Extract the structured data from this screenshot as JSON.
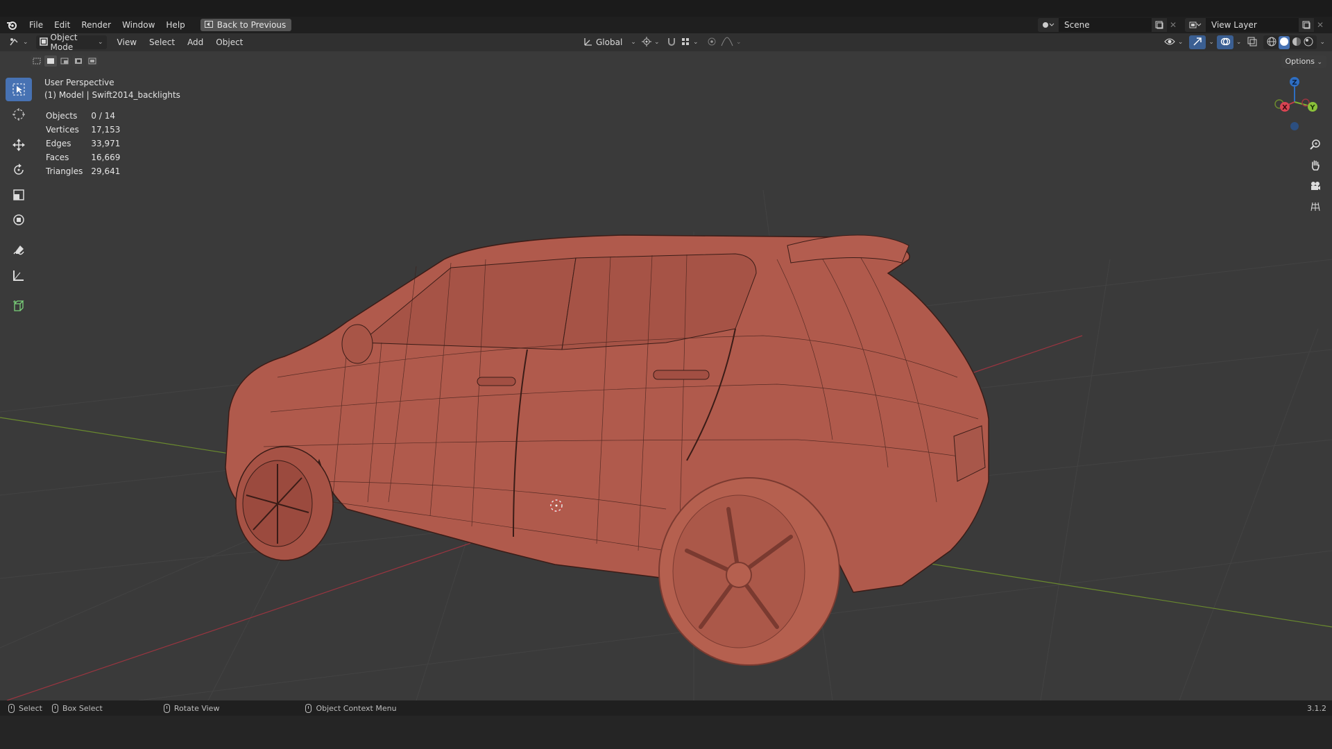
{
  "menubar": {
    "items": [
      "File",
      "Edit",
      "Render",
      "Window",
      "Help"
    ],
    "back_button": "Back to Previous",
    "scene": "Scene",
    "view_layer": "View Layer"
  },
  "header": {
    "mode": "Object Mode",
    "menus": [
      "View",
      "Select",
      "Add",
      "Object"
    ],
    "transform_orientation": "Global"
  },
  "viewport": {
    "perspective": "User Perspective",
    "object_info": "(1) Model | Swift2014_backlights",
    "options_label": "Options",
    "stats": [
      {
        "label": "Objects",
        "value": "0 / 14"
      },
      {
        "label": "Vertices",
        "value": "17,153"
      },
      {
        "label": "Edges",
        "value": "33,971"
      },
      {
        "label": "Faces",
        "value": "16,669"
      },
      {
        "label": "Triangles",
        "value": "29,641"
      }
    ],
    "gizmo_labels": {
      "z": "Z",
      "x": "X",
      "y": "Y"
    },
    "tools": [
      "select-box-icon",
      "cursor-icon",
      "move-icon",
      "rotate-icon",
      "scale-icon",
      "transform-icon",
      "annotate-icon",
      "measure-icon",
      "add-cube-icon"
    ],
    "nav": [
      "zoom-icon",
      "hand-pan-icon",
      "camera-icon",
      "grid-icon"
    ]
  },
  "statusbar": {
    "select": "Select",
    "box_select": "Box Select",
    "rotate_view": "Rotate View",
    "context_menu": "Object Context Menu",
    "version": "3.1.2"
  },
  "colors": {
    "model": "#b05a4c",
    "active_tool": "#4772b3",
    "axis_x": "#9b3540",
    "axis_y": "#6a8a2e"
  }
}
